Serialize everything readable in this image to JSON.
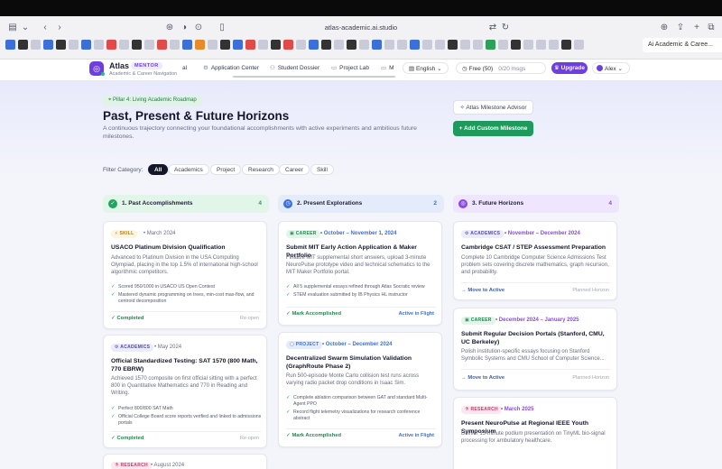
{
  "browser": {
    "url": "atlas-academic.ai.studio",
    "active_tab_title": "Ai Academic & Caree..."
  },
  "app": {
    "brand": "Atlas",
    "badge": "MENTOR",
    "subtitle": "Academic & Career Navigation",
    "nav": [
      {
        "label": "al",
        "icon": ""
      },
      {
        "label": "Application Center",
        "icon": "⚙"
      },
      {
        "label": "Student Dossier",
        "icon": "👤"
      },
      {
        "label": "Project Lab",
        "icon": "▭"
      },
      {
        "label": "M",
        "icon": "▭"
      }
    ],
    "language": "English",
    "plan": "Free (50)",
    "msgs": "0/20 msgs",
    "upgrade": "Upgrade",
    "user": "Alex"
  },
  "hero": {
    "pillar": "Pillar 4: Living Academic Roadmap",
    "title": "Past, Present & Future Horizons",
    "subtitle": "A continuous trajectory connecting your foundational accomplishments with active experiments and ambitious future milestones.",
    "advisor_label": "Atlas Milestone Advisor",
    "add_label": "+ Add Custom Milestone"
  },
  "filters": {
    "label": "Filter Category:",
    "chips": [
      "All",
      "Academics",
      "Project",
      "Research",
      "Career",
      "Skill"
    ]
  },
  "columns": [
    {
      "num": "✓",
      "title": "1. Past Accomplishments",
      "count": "4"
    },
    {
      "num": "◷",
      "title": "2. Present Explorations",
      "count": "2"
    },
    {
      "num": "◎",
      "title": "3. Future Horizons",
      "count": "4"
    }
  ],
  "cards": {
    "c1a": {
      "tag": "SKILL",
      "date": "March 2024",
      "title": "USACO Platinum Division Qualification",
      "desc": "Advanced to Platinum Division in the USA Computing Olympiad, placing in the top 1.5% of international high-school algorithmic competitors.",
      "bullets": [
        "Scored 950/1000 in USACO US Open Contest",
        "Mastered dynamic programming on trees, min-cost max-flow, and centroid decomposition"
      ],
      "foot_l": "✓ Completed",
      "foot_r": "Re-open"
    },
    "c1b": {
      "tag": "ACADEMICS",
      "date": "May 2024",
      "title": "Official Standardized Testing: SAT 1570 (800 Math, 770 EBRW)",
      "desc": "Achieved 1570 composite on first official sitting with a perfect 800 in Quantitative Mathematics and 770 in Reading and Writing.",
      "bullets": [
        "Perfect 800/800 SAT Math",
        "Official College Board score reports verified and linked to admissions portals"
      ],
      "foot_l": "✓ Completed",
      "foot_r": "Re-open"
    },
    "c1c": {
      "tag": "RESEARCH",
      "date": "August 2024"
    },
    "c2a": {
      "tag": "CAREER",
      "date": "October – November 1, 2024",
      "title": "Submit MIT Early Action Application & Maker Portfolio",
      "desc": "Finalize MIT supplemental short answers, upload 3-minute NeuroPulse prototype video and technical schematics to the MIT Maker Portfolio portal.",
      "bullets": [
        "All 5 supplemental essays refined through Atlas Socratic review",
        "STEM evaluation submitted by IB Physics HL instructor"
      ],
      "foot_l": "✓ Mark Accomplished",
      "foot_r": "Active in Flight"
    },
    "c2b": {
      "tag": "PROJECT",
      "date": "October – December 2024",
      "title": "Decentralized Swarm Simulation Validation (GraphRoute Phase 2)",
      "desc": "Run 500-episode Monte Carlo collision test runs across varying radio packet drop conditions in Isaac Sim.",
      "bullets": [
        "Complete ablation comparison between GAT and standard Multi-Agent PPO",
        "Record flight telemetry visualizations for research conference abstract"
      ],
      "foot_l": "✓ Mark Accomplished",
      "foot_r": "Active in Flight"
    },
    "c3a": {
      "tag": "ACADEMICS",
      "date": "November – December 2024",
      "title": "Cambridge CSAT / STEP Assessment Preparation",
      "desc": "Complete 10 Cambridge Computer Science Admissions Test problem sets covering discrete mathematics, graph recursion, and probability.",
      "foot_l": "→ Move to Active",
      "foot_r": "Planned Horizon"
    },
    "c3b": {
      "tag": "CAREER",
      "date": "December 2024 – January 2025",
      "title": "Submit Regular Decision Portals (Stanford, CMU, UC Berkeley)",
      "desc": "Polish institution-specific essays focusing on Stanford Symbolic Systems and CMU School of Computer Science...",
      "foot_l": "→ Move to Active",
      "foot_r": "Planned Horizon"
    },
    "c3c": {
      "tag": "RESEARCH",
      "date": "March 2025",
      "title": "Present NeuroPulse at Regional IEEE Youth Symposium",
      "desc": "Deliver 15-minute podium presentation on TinyML bio-signal processing for ambulatory healthcare."
    }
  }
}
